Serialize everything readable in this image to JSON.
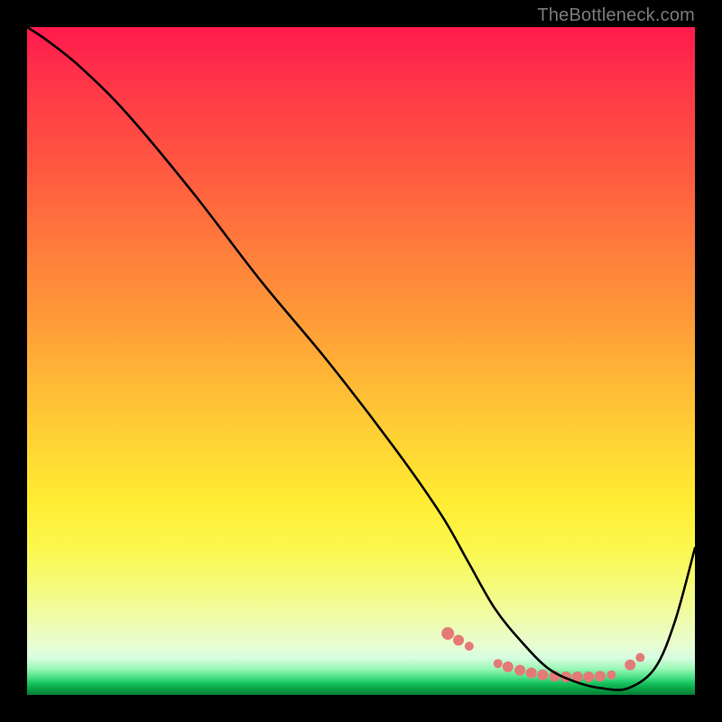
{
  "watermark": "TheBottleneck.com",
  "chart_data": {
    "type": "line",
    "title": "",
    "xlabel": "",
    "ylabel": "",
    "xlim": [
      0,
      100
    ],
    "ylim": [
      0,
      100
    ],
    "series": [
      {
        "name": "bottleneck-curve",
        "x": [
          0,
          3,
          8,
          15,
          25,
          35,
          45,
          55,
          62,
          66,
          70,
          74,
          78,
          82,
          86,
          90,
          94,
          97,
          100
        ],
        "values": [
          100,
          98,
          94,
          87,
          75,
          62,
          50,
          37,
          27,
          20,
          13,
          8,
          4,
          2,
          1,
          1,
          4,
          11,
          22
        ]
      }
    ],
    "markers": {
      "name": "highlight-dots",
      "color": "#e47a76",
      "x": [
        63.0,
        64.6,
        66.2,
        70.5,
        72.0,
        73.8,
        75.5,
        77.2,
        79.0,
        80.7,
        82.4,
        84.1,
        85.8,
        87.5,
        90.3,
        91.8
      ],
      "values": [
        9.2,
        8.2,
        7.3,
        4.7,
        4.2,
        3.7,
        3.3,
        3.0,
        2.8,
        2.7,
        2.7,
        2.7,
        2.8,
        3.0,
        4.5,
        5.6
      ],
      "radius": [
        7,
        6,
        5,
        5,
        6,
        6,
        6,
        6,
        6,
        6,
        6,
        6,
        6,
        5,
        6,
        5
      ]
    }
  }
}
